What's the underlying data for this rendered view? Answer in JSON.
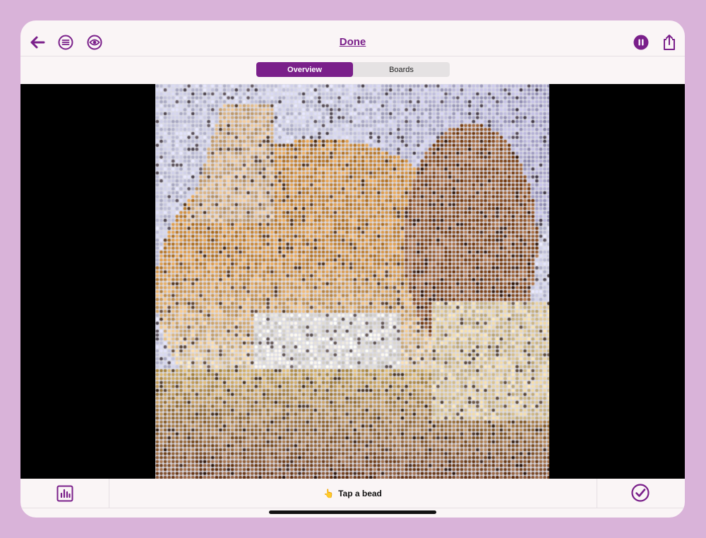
{
  "header": {
    "title": "Done",
    "icons": {
      "back": "back-arrow-icon",
      "menu": "list-circle-icon",
      "preview": "eye-icon",
      "pause": "pause-icon",
      "share": "share-icon"
    }
  },
  "tabs": [
    {
      "label": "Overview",
      "active": true
    },
    {
      "label": "Boards",
      "active": false
    }
  ],
  "footer": {
    "hint_emoji": "👆",
    "hint_text": "Tap a bead",
    "icons": {
      "stats": "bar-chart-icon",
      "complete": "check-circle-icon"
    }
  },
  "colors": {
    "accent": "#7a1f8a",
    "frame": "#d9b3d9",
    "surface": "#faf5f6"
  }
}
